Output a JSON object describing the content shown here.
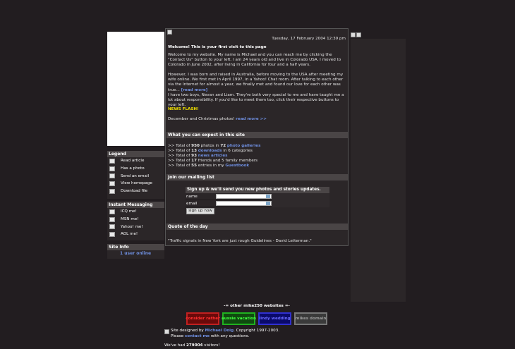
{
  "legend": {
    "title": "Legend",
    "items": [
      "Read article",
      "Has a photo",
      "Send an email",
      "View homepage",
      "Download file"
    ]
  },
  "im": {
    "title": "Instant Messaging",
    "items": [
      "ICQ me!",
      "MSN me!",
      "Yahoo! me!",
      "AOL me!"
    ]
  },
  "siteinfo": {
    "title": "Site Info",
    "online": "1 user online"
  },
  "main": {
    "date": "Tuesday, 17 February 2004 12:39 pm",
    "welcome_title": "Welcome! This is your first visit to this page",
    "p1": "Welcome to my website. My name is Michael and you can reach me by clicking the \"Contact Us\" button to your left. I am 24 years old and live in Colorado USA. I moved to Colorado in June 2002, after living in California for four and a half years.",
    "p2": "However, I was born and raised in Australia, before moving to the USA after meeting my wife online. We first met in April 1997, in a Yahoo! Chat room. After talking to each other via the Internet for almost a year, we finally met and found our love for each other was true...",
    "p2_link": "[read more]",
    "p3": "I have two boys, Nevan and Liam. They're both very special to me and have taught me a lot about responsibility. If you'd like to meet them too, click their respective buttons to your left.",
    "newsflash": "NEWS FLASH!",
    "news_text": "December and Christmas photos!",
    "news_link": "read more >>"
  },
  "expect": {
    "title": "What you can expect in this site",
    "lines": [
      {
        "pre": ">> Total of ",
        "n1": "950",
        "mid": " photos in ",
        "n2": "72",
        "sp": " ",
        "link": "photo galleries",
        "post": ""
      },
      {
        "pre": ">> Total of ",
        "n1": "13",
        "mid": " ",
        "n2": "",
        "sp": "",
        "link": "downloads",
        "post": " in 6 categories"
      },
      {
        "pre": ">> Total of ",
        "n1": "93",
        "mid": " ",
        "n2": "",
        "sp": "",
        "link": "news articles",
        "post": ""
      },
      {
        "pre": ">> Total of ",
        "n1": "17",
        "mid": " friends and 5 family members",
        "n2": "",
        "sp": "",
        "link": "",
        "post": ""
      },
      {
        "pre": ">> Total of ",
        "n1": "55",
        "mid": " entries in my ",
        "n2": "",
        "sp": "",
        "link": "Guestbook",
        "post": ""
      }
    ]
  },
  "mailing": {
    "title": "Join our mailing list",
    "box_title": "Sign up & we'll send you new photos and stories updates.",
    "name_label": "name",
    "email_label": "email",
    "button": "sign up now"
  },
  "quote": {
    "title": "Quote of the day",
    "text": "\"Traffic signals in New York are just rough Guidelines - David Letterman.\""
  },
  "footer": {
    "other_title": "-= other mike250 websites =-",
    "banners": [
      "consider rather",
      "aussie vacation",
      "lindy wedding",
      "mikes domain"
    ],
    "credit_pre": "Site designed by ",
    "credit_link": "Michael Doig",
    "credit_post": ". Copyright 1997-2003.",
    "contact_pre": "Please ",
    "contact_link": "contact me",
    "contact_post": " with any questions.",
    "visitors_pre": "We've had ",
    "visitors_count": "279004",
    "visitors_post": " visitors!"
  },
  "colors": {
    "background": "#221d20",
    "panel": "#2b2628",
    "header": "#4a4546",
    "link": "#6f8fe0",
    "newsflash": "#f0e000"
  }
}
